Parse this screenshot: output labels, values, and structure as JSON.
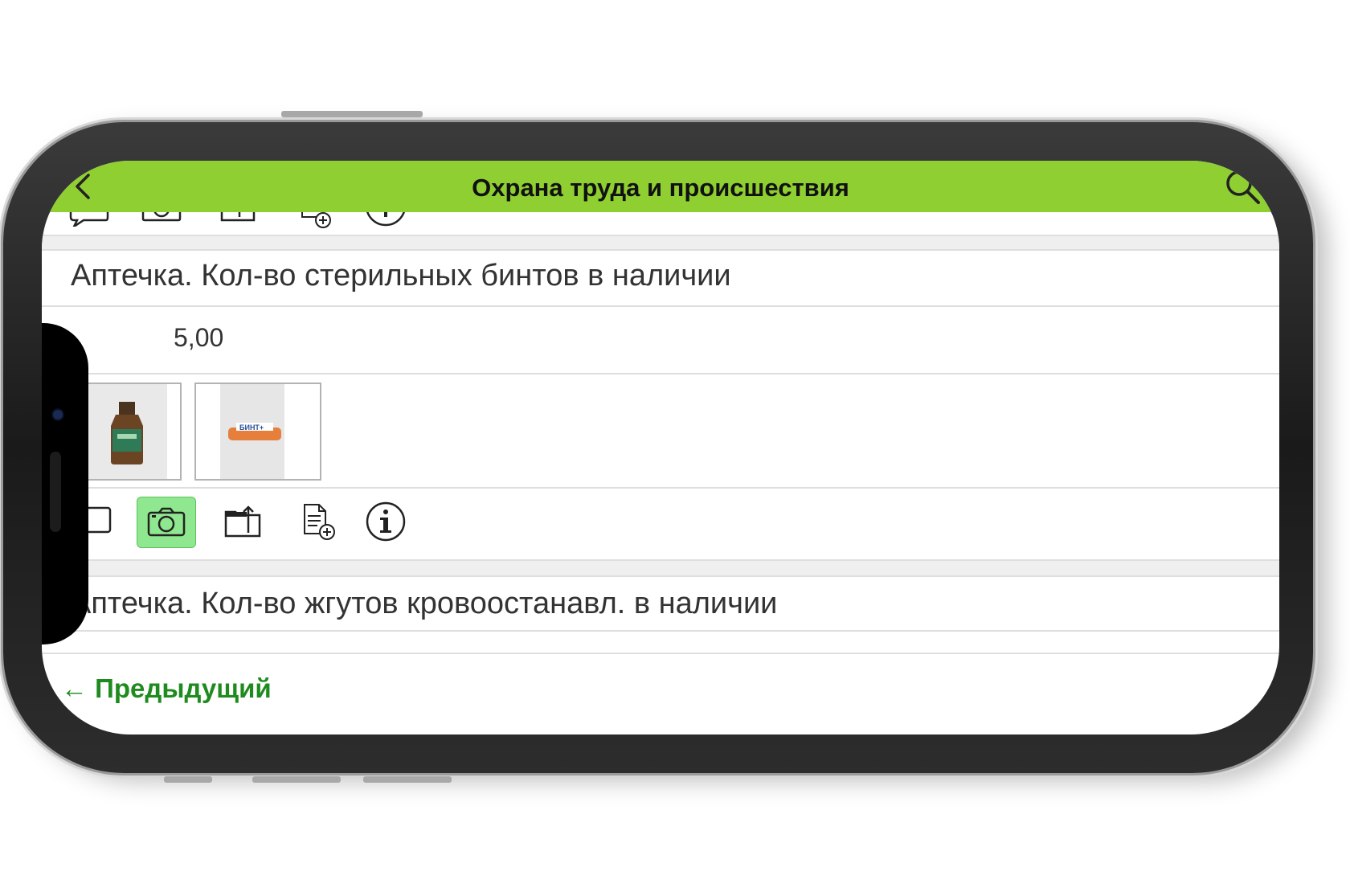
{
  "header": {
    "title": "Охрана труда и происшествия"
  },
  "items": [
    {
      "label": "Аптечка. Кол-во стерильных бинтов в наличии",
      "value": "5,00",
      "photos": [
        {
          "icon": "bottle-photo-icon"
        },
        {
          "icon": "bandage-photo-icon",
          "caption": "БИНТ+"
        }
      ],
      "toolbar": [
        "comment-icon",
        "camera-icon",
        "folder-upload-icon",
        "add-document-icon",
        "info-icon"
      ],
      "active_tool": "camera-icon"
    },
    {
      "label": "Аптечка. Кол-во жгутов кровоостанавл. в наличии"
    }
  ],
  "footer": {
    "prev_label": "← Предыдущий"
  },
  "colors": {
    "nav_bar": "#8fcf32",
    "active_tool": "#8fe88f",
    "prev_link": "#1f8b1f"
  }
}
